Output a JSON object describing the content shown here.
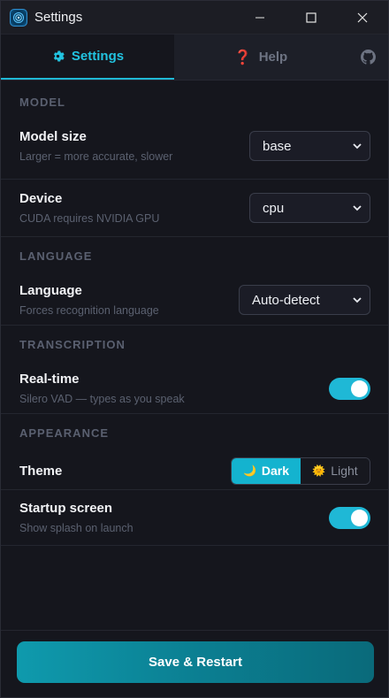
{
  "window": {
    "title": "Settings"
  },
  "tabs": {
    "settings": "Settings",
    "help": "Help"
  },
  "sections": {
    "model": "MODEL",
    "language": "LANGUAGE",
    "transcription": "TRANSCRIPTION",
    "appearance": "APPEARANCE"
  },
  "model_size": {
    "label": "Model size",
    "desc": "Larger = more accurate, slower",
    "value": "base"
  },
  "device": {
    "label": "Device",
    "desc": "CUDA requires NVIDIA GPU",
    "value": "cpu"
  },
  "language": {
    "label": "Language",
    "desc": "Forces recognition language",
    "value": "Auto-detect"
  },
  "realtime": {
    "label": "Real-time",
    "desc": "Silero VAD — types as you speak",
    "enabled": true
  },
  "theme": {
    "label": "Theme",
    "dark": "Dark",
    "light": "Light",
    "selected": "Dark"
  },
  "startup": {
    "label": "Startup screen",
    "desc": "Show splash on launch",
    "enabled": true
  },
  "footer": {
    "save_label": "Save & Restart"
  },
  "colors": {
    "accent": "#1fb8d6",
    "background": "#15161d",
    "muted": "#5b6170"
  },
  "icons": {
    "app": "app-logo-icon",
    "settings_tab": "gear-icon",
    "help_tab": "question-mark-icon",
    "github": "github-icon",
    "theme_dark": "moon-icon",
    "theme_light": "sun-icon"
  }
}
